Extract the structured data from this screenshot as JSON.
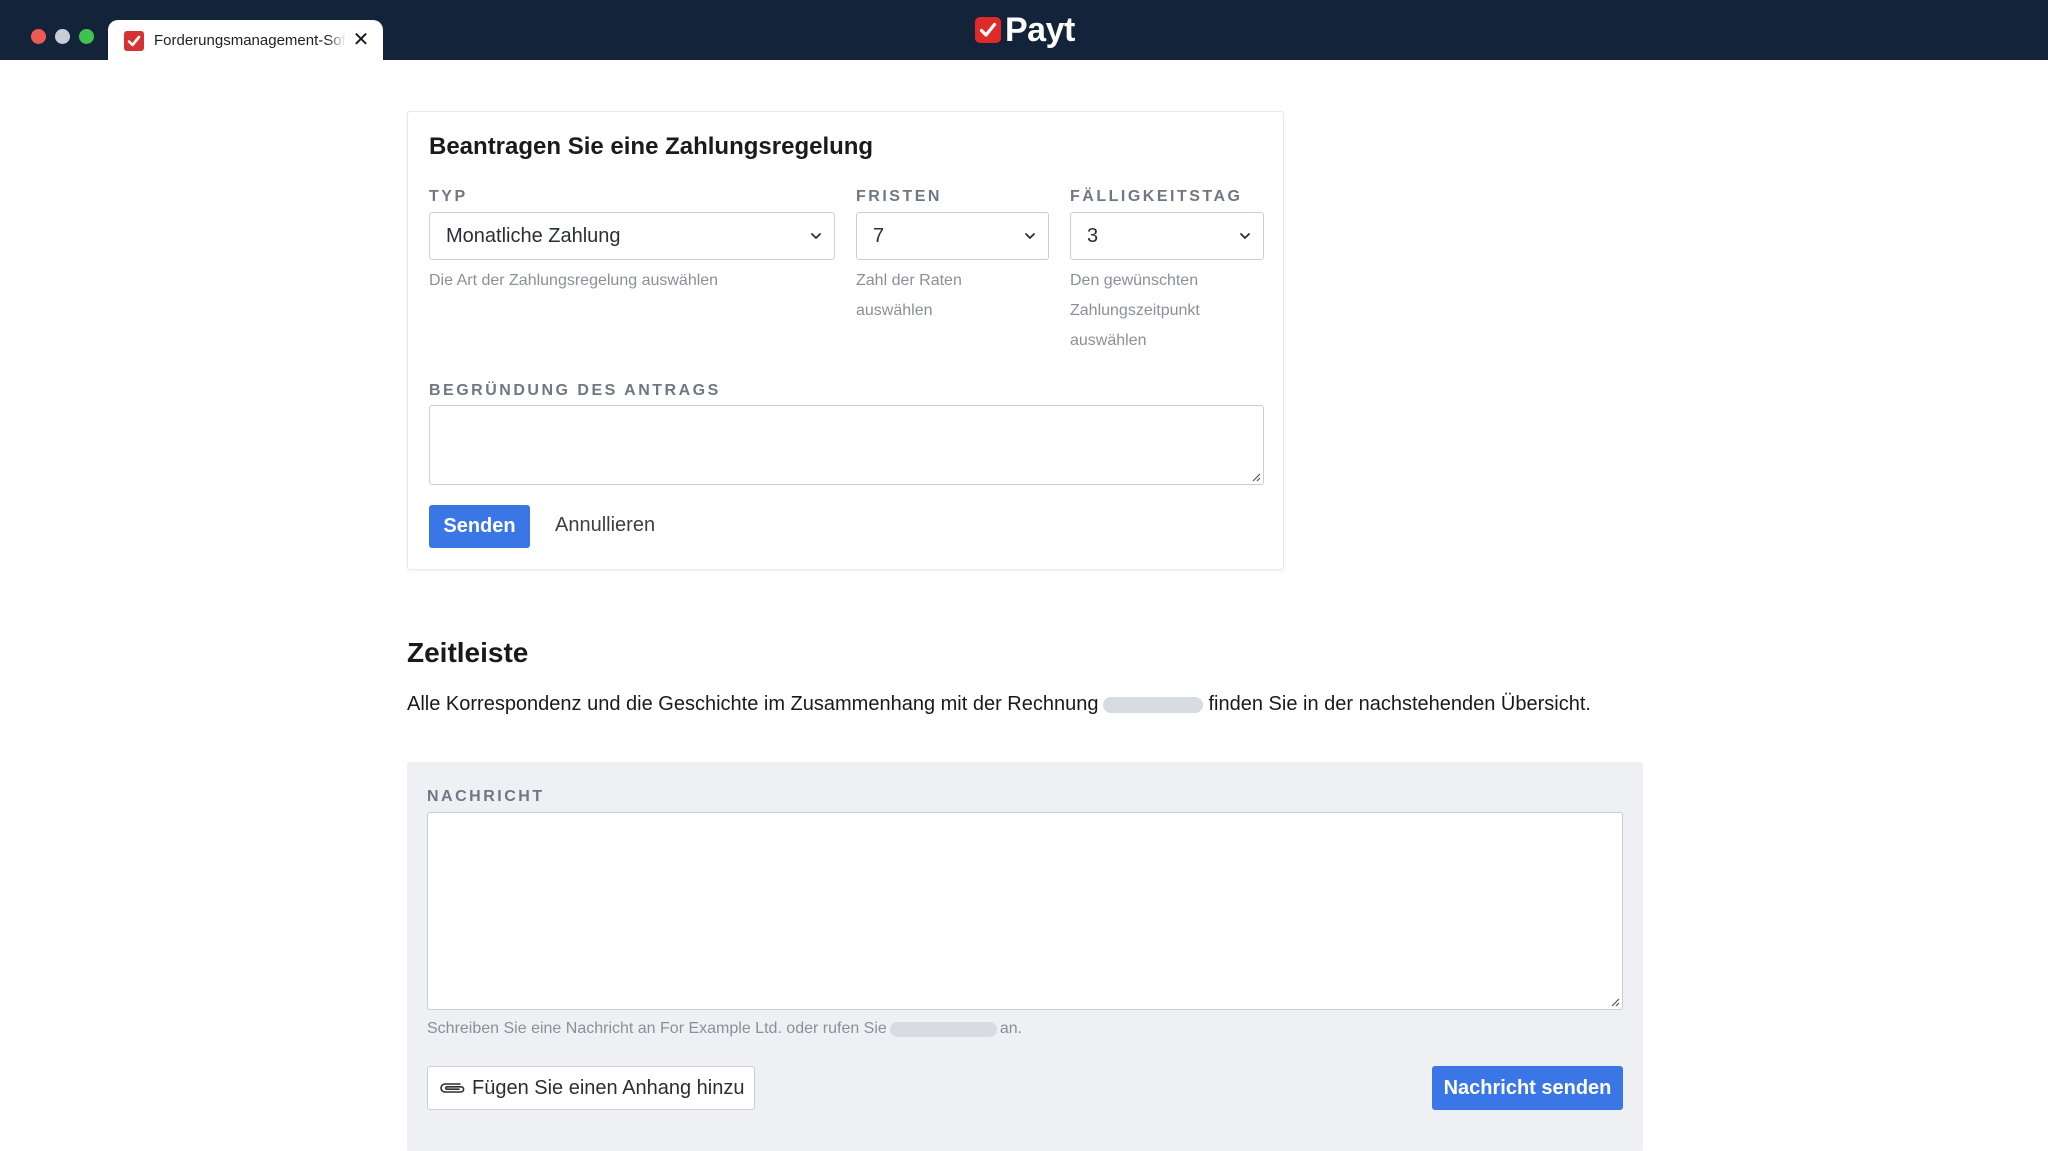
{
  "browser": {
    "tab_title": "Forderungsmanagement-Software"
  },
  "brand": {
    "name": "Payt",
    "accent": "#e02a2a"
  },
  "form": {
    "title": "Beantragen Sie eine Zahlungsregelung",
    "type": {
      "label": "TYP",
      "value": "Monatliche Zahlung",
      "help": "Die Art der Zahlungsregelung auswählen"
    },
    "terms": {
      "label": "FRISTEN",
      "value": "7",
      "help_line1": "Zahl der Raten",
      "help_line2": "auswählen"
    },
    "due_day": {
      "label": "FÄLLIGKEITSTAG",
      "value": "3",
      "help_line1": "Den gewünschten",
      "help_line2": "Zahlungszeitpunkt",
      "help_line3": "auswählen"
    },
    "reason": {
      "label": "BEGRÜNDUNG DES ANTRAGS",
      "value": ""
    },
    "submit_label": "Senden",
    "cancel_label": "Annullieren"
  },
  "timeline": {
    "title": "Zeitleiste",
    "desc_before": "Alle Korrespondenz und die Geschichte im Zusammenhang mit der Rechnung",
    "desc_after": "finden Sie in der nachstehenden Übersicht."
  },
  "message": {
    "label": "NACHRICHT",
    "value": "",
    "help_before": "Schreiben Sie eine Nachricht an For Example Ltd. oder rufen Sie",
    "help_after": "an.",
    "attach_label": "Fügen Sie einen Anhang hinzu",
    "send_label": "Nachricht senden"
  },
  "colors": {
    "topbar": "#13243a",
    "primary_button": "#3b76e7",
    "panel": "#eef0f3"
  }
}
